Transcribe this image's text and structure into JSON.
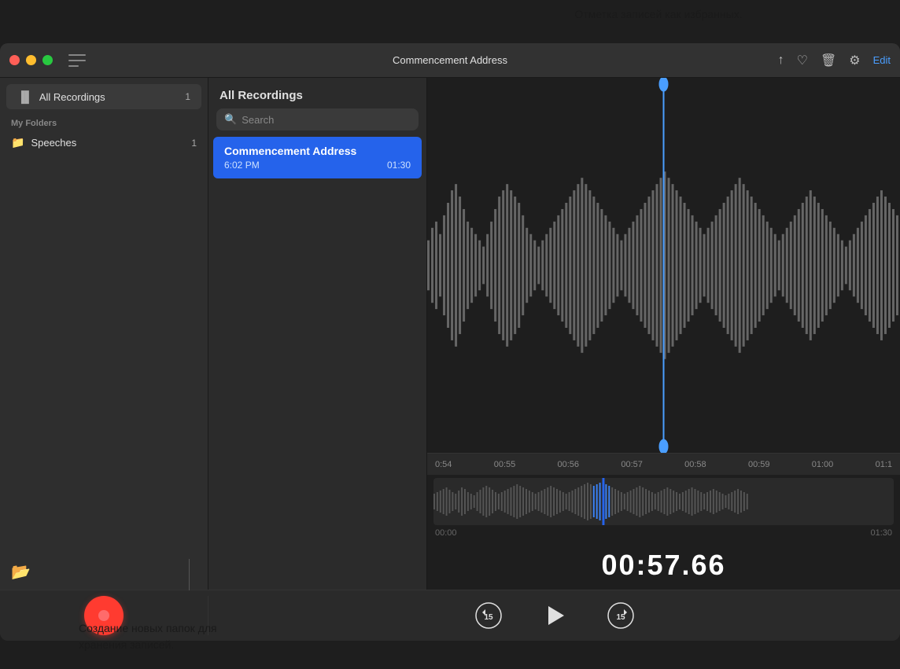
{
  "tooltip_top": "Отметка записей как избранных.",
  "tooltip_bottom_line1": "Создание новых папок для",
  "tooltip_bottom_line2": "хранения записей.",
  "titlebar": {
    "title": "Commencement Address",
    "edit_label": "Edit"
  },
  "sidebar": {
    "all_recordings_label": "All Recordings",
    "all_recordings_badge": "1",
    "my_folders_label": "My Folders",
    "folder_name": "Speeches",
    "folder_badge": "1"
  },
  "recordings_panel": {
    "header": "All Recordings",
    "search_placeholder": "Search",
    "items": [
      {
        "title": "Commencement Address",
        "time": "6:02 PM",
        "duration": "01:30"
      }
    ]
  },
  "waveform": {
    "ruler_labels": [
      "0:54",
      "00:55",
      "00:56",
      "00:57",
      "00:58",
      "00:59",
      "01:00",
      "01:1"
    ],
    "mini_ruler_start": "00:00",
    "mini_ruler_end": "01:30",
    "timer": "00:57.66"
  },
  "controls": {
    "skip_back_label": "15",
    "skip_forward_label": "15"
  }
}
